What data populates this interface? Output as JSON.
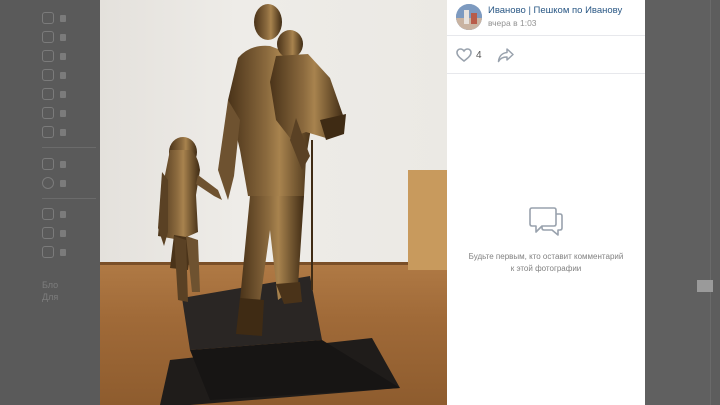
{
  "post": {
    "author": "Иваново | Пешком по Иванову",
    "time": "вчера в 1:03"
  },
  "actions": {
    "likes": "4"
  },
  "comments": {
    "empty_text": "Будьте первым, кто оставит комментарий к этой фотографии"
  },
  "background": {
    "footer_line1": "Бло",
    "footer_line2": "Для"
  },
  "icons": {
    "like": "heart-icon",
    "share": "share-arrow-icon",
    "comment": "comment-bubble-icon"
  },
  "colors": {
    "link": "#2a5885",
    "muted": "#939393",
    "icon": "#99a2ad"
  }
}
